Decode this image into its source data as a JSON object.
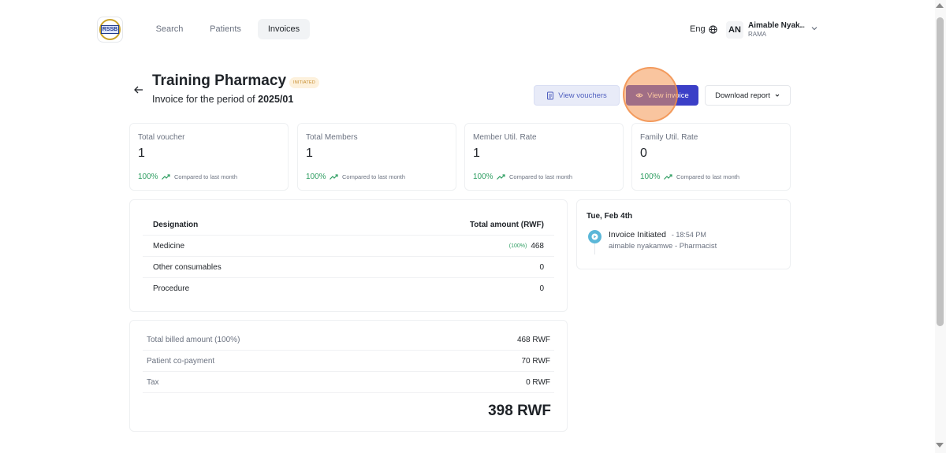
{
  "app": {
    "logo_text": "RSSB"
  },
  "nav": {
    "tabs": [
      {
        "label": "Search",
        "active": false
      },
      {
        "label": "Patients",
        "active": false
      },
      {
        "label": "Invoices",
        "active": true
      }
    ],
    "language": "Eng",
    "user": {
      "initials": "AN",
      "name": "Aimable Nyak...",
      "org": "RAMA"
    }
  },
  "header": {
    "title": "Training Pharmacy",
    "status": "INITIATED",
    "subtitle_prefix": "Invoice for the period of",
    "period": "2025/01",
    "buttons": {
      "vouchers": "View vouchers",
      "invoice": "View invoice",
      "download": "Download report"
    }
  },
  "stats": [
    {
      "label": "Total voucher",
      "value": "1",
      "change": "100%",
      "compare": "Compared to last month"
    },
    {
      "label": "Total Members",
      "value": "1",
      "change": "100%",
      "compare": "Compared to last month"
    },
    {
      "label": "Member Util. Rate",
      "value": "1",
      "change": "100%",
      "compare": "Compared to last month"
    },
    {
      "label": "Family Util. Rate",
      "value": "0",
      "change": "100%",
      "compare": "Compared to last month"
    }
  ],
  "designation_table": {
    "headers": {
      "designation": "Designation",
      "amount": "Total amount (RWF)"
    },
    "rows": [
      {
        "name": "Medicine",
        "pct": "(100%)",
        "amount": "468"
      },
      {
        "name": "Other consumables",
        "pct": "",
        "amount": "0"
      },
      {
        "name": "Procedure",
        "pct": "",
        "amount": "0"
      }
    ]
  },
  "totals": {
    "rows": [
      {
        "label": "Total billed amount (100%)",
        "value": "468 RWF"
      },
      {
        "label": "Patient co-payment",
        "value": "70 RWF"
      },
      {
        "label": "Tax",
        "value": "0 RWF"
      }
    ],
    "grand_total": "398 RWF"
  },
  "timeline": {
    "date": "Tue, Feb 4th",
    "events": [
      {
        "title": "Invoice Initiated",
        "time": "- 18:54 PM",
        "actor": "aimable nyakamwe - Pharmacist"
      }
    ]
  },
  "colors": {
    "primary": "#3b3fc7",
    "success": "#2f9e62",
    "badge_text": "#c58a2a",
    "badge_bg": "#fdf1dc",
    "timeline_dot": "#5bb7d8"
  }
}
